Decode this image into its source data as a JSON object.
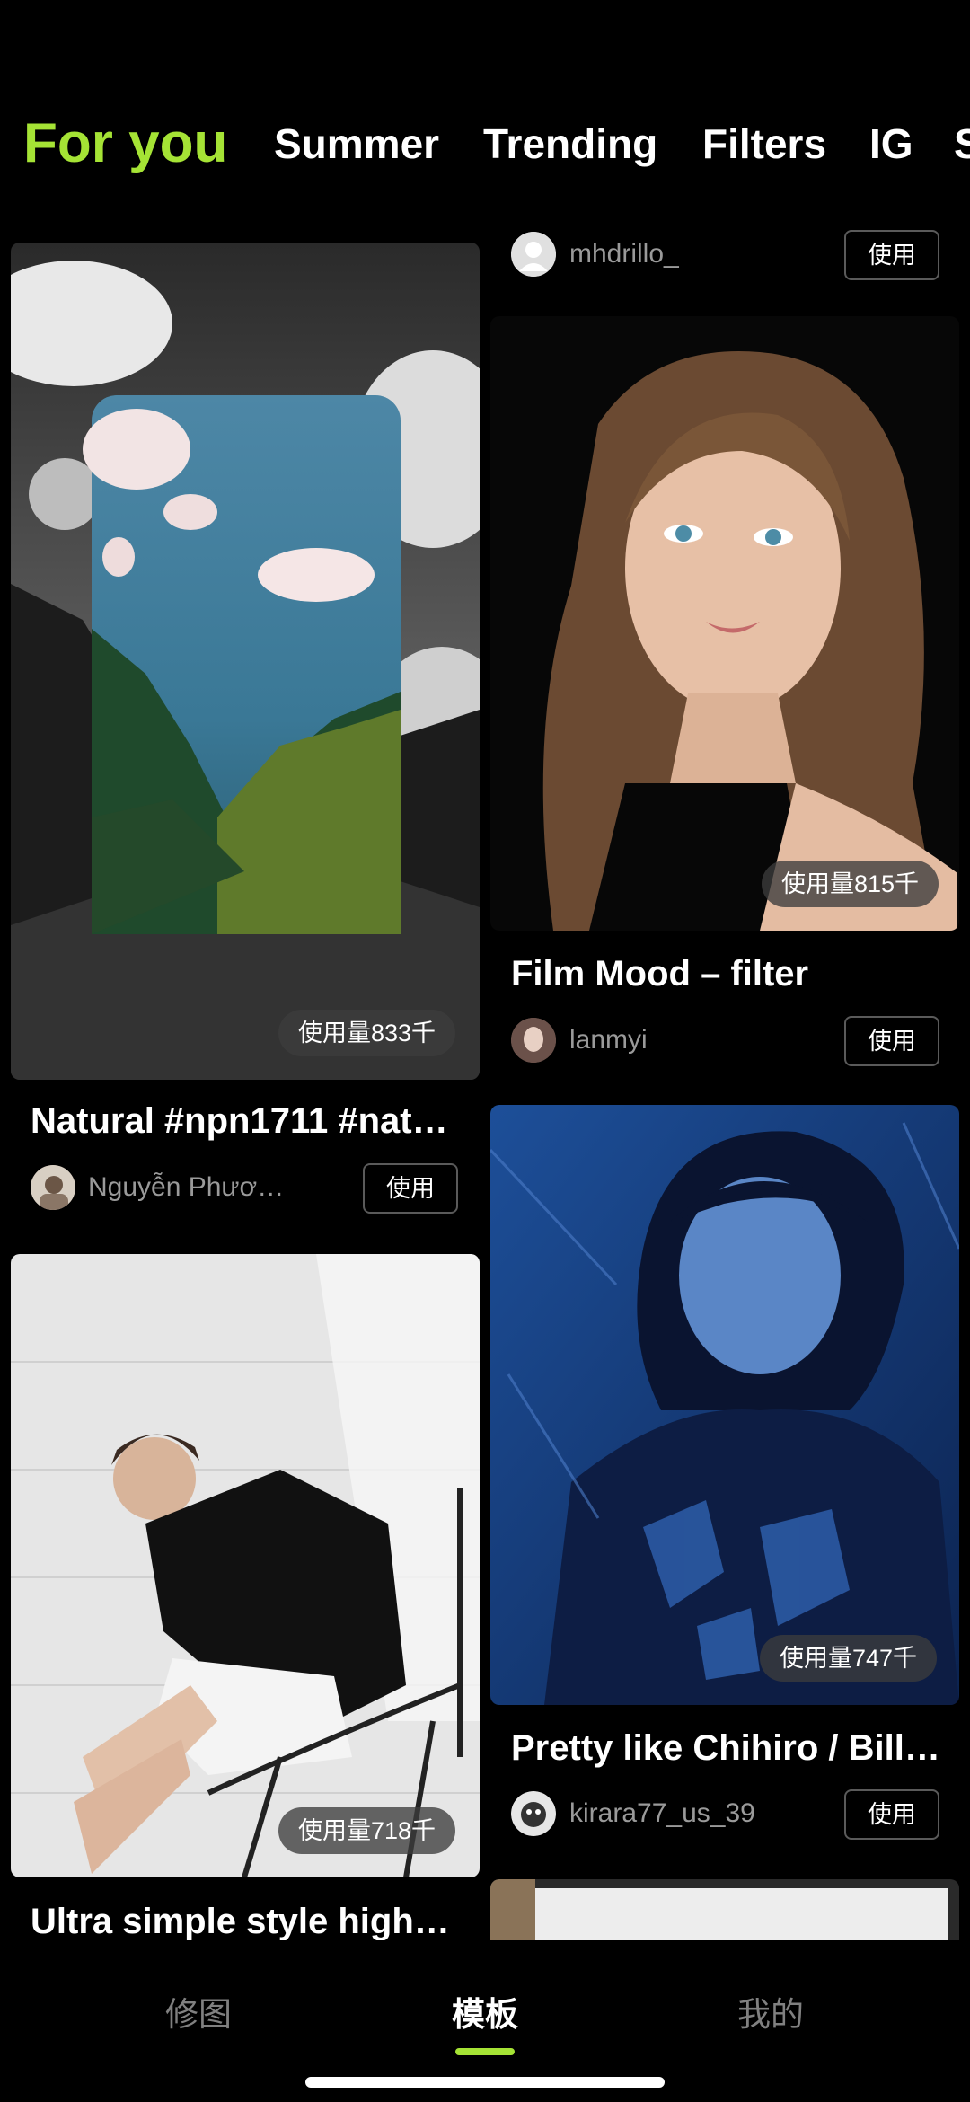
{
  "tabs": [
    "For you",
    "Summer",
    "Trending",
    "Filters",
    "IG",
    "S"
  ],
  "accent_color": "#a5e335",
  "cards": {
    "natural": {
      "badge": "使用量833千",
      "title": "Natural #npn1711 #nat…",
      "user": "Nguyễn Phươ…",
      "button": "使用"
    },
    "mhdrillo": {
      "user": "mhdrillo_",
      "button": "使用"
    },
    "film_mood": {
      "badge": "使用量815千",
      "title": "Film Mood – filter",
      "user": "lanmyi",
      "button": "使用"
    },
    "pretty": {
      "badge": "使用量747千",
      "title": "Pretty like Chihiro / Bill…",
      "user": "kirara77_us_39",
      "button": "使用"
    },
    "ultra": {
      "badge": "使用量718千",
      "title": "Ultra simple style high…"
    }
  },
  "bottom_nav": {
    "edit": "修图",
    "templates": "模板",
    "me": "我的"
  }
}
